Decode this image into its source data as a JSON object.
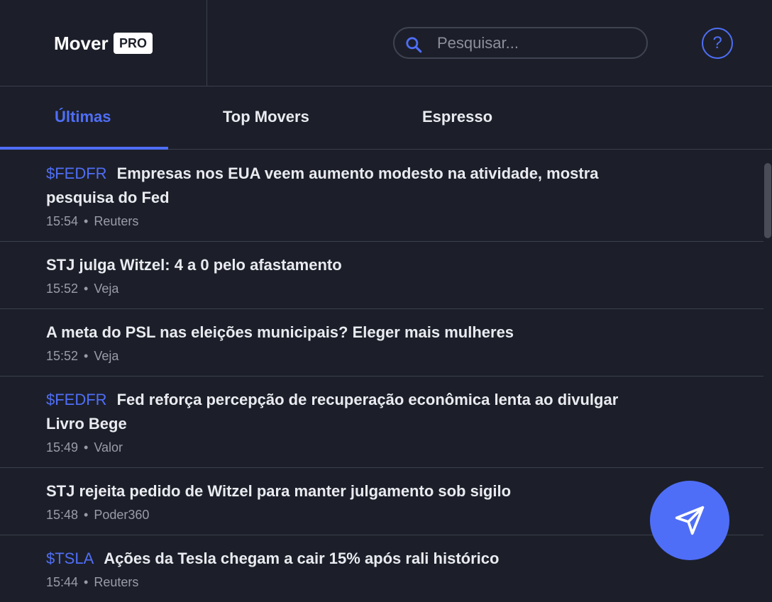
{
  "brand": {
    "name": "Mover",
    "badge": "PRO"
  },
  "search": {
    "placeholder": "Pesquisar...",
    "value": ""
  },
  "help": {
    "label": "?"
  },
  "tabs": [
    {
      "label": "Últimas",
      "active": true
    },
    {
      "label": "Top Movers",
      "active": false
    },
    {
      "label": "Espresso",
      "active": false
    }
  ],
  "news": [
    {
      "ticker": "$FEDFR",
      "title": "Empresas nos EUA veem aumento modesto na atividade, mostra pesquisa do Fed",
      "time": "15:54",
      "source": "Reuters"
    },
    {
      "ticker": "",
      "title": "STJ julga Witzel: 4 a 0 pelo afastamento",
      "time": "15:52",
      "source": "Veja"
    },
    {
      "ticker": "",
      "title": "A meta do PSL nas eleições municipais? Eleger mais mulheres",
      "time": "15:52",
      "source": "Veja"
    },
    {
      "ticker": "$FEDFR",
      "title": "Fed reforça percepção de recuperação econômica lenta ao divulgar Livro Bege",
      "time": "15:49",
      "source": "Valor"
    },
    {
      "ticker": "",
      "title": "STJ rejeita pedido de Witzel para manter julgamento sob sigilo",
      "time": "15:48",
      "source": "Poder360"
    },
    {
      "ticker": "$TSLA",
      "title": "Ações da Tesla chegam a cair 15% após rali histórico",
      "time": "15:44",
      "source": "Reuters"
    }
  ],
  "meta_separator": "•",
  "colors": {
    "background": "#1c1f29",
    "accent": "#4f6ef7",
    "border": "#3b3f4c",
    "text": "#e9ebf0",
    "muted": "#9a9da8"
  },
  "icons": {
    "search": "search-icon",
    "help": "help-icon",
    "send": "send-icon"
  }
}
